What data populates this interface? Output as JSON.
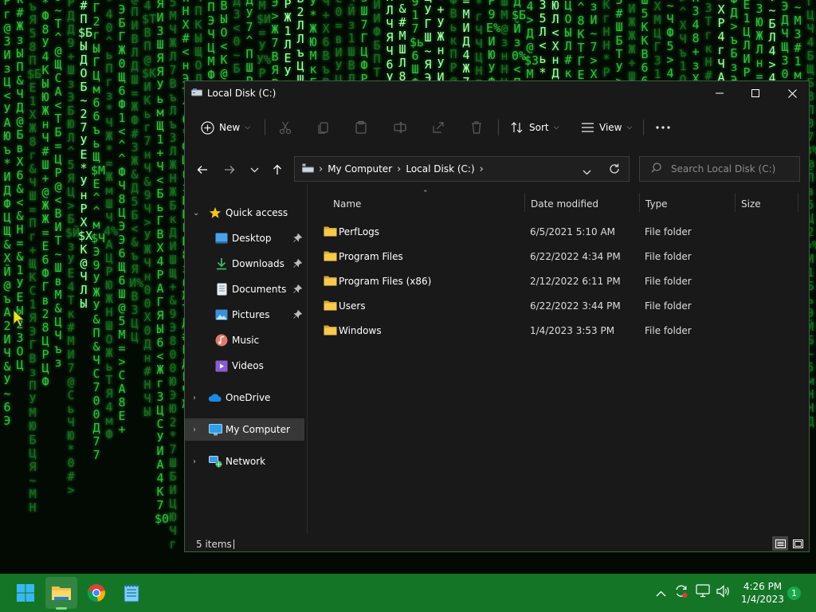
{
  "window": {
    "title": "Local Disk (C:)",
    "controls": [
      "minimize",
      "maximize",
      "close"
    ]
  },
  "toolbar": {
    "new_label": "New",
    "sort_label": "Sort",
    "view_label": "View",
    "disabled_actions": [
      "cut-icon",
      "copy-icon",
      "paste-icon",
      "rename-icon",
      "share-icon",
      "delete-icon"
    ]
  },
  "address": {
    "crumbs": [
      "My Computer",
      "Local Disk (C:)"
    ]
  },
  "search": {
    "placeholder": "Search Local Disk (C:)"
  },
  "nav": {
    "quick_access": "Quick access",
    "items": [
      {
        "label": "Desktop",
        "pinned": true
      },
      {
        "label": "Downloads",
        "pinned": true
      },
      {
        "label": "Documents",
        "pinned": true
      },
      {
        "label": "Pictures",
        "pinned": true
      },
      {
        "label": "Music",
        "pinned": false
      },
      {
        "label": "Videos",
        "pinned": false
      }
    ],
    "onedrive": "OneDrive",
    "my_computer": "My Computer",
    "network": "Network",
    "selected": "My Computer"
  },
  "columns": {
    "name": "Name",
    "date": "Date modified",
    "type": "Type",
    "size": "Size"
  },
  "files": [
    {
      "name": "PerfLogs",
      "date": "6/5/2021 5:10 AM",
      "type": "File folder"
    },
    {
      "name": "Program Files",
      "date": "6/22/2022 4:34 PM",
      "type": "File folder"
    },
    {
      "name": "Program Files (x86)",
      "date": "2/12/2022 6:11 PM",
      "type": "File folder"
    },
    {
      "name": "Users",
      "date": "6/22/2022 3:44 PM",
      "type": "File folder"
    },
    {
      "name": "Windows",
      "date": "1/4/2023 3:53 PM",
      "type": "File folder"
    }
  ],
  "status": {
    "count": "5 items"
  },
  "taskbar": {
    "apps": [
      "start-icon",
      "file-explorer-icon",
      "chrome-icon",
      "notepad-icon"
    ],
    "time": "4:26 PM",
    "date": "1/4/2023",
    "notifications": "1"
  },
  "colors": {
    "taskbar": "#157527",
    "window_bg": "#191919",
    "folder": "#f3c04b",
    "matrix": "#2fbf3a"
  }
}
